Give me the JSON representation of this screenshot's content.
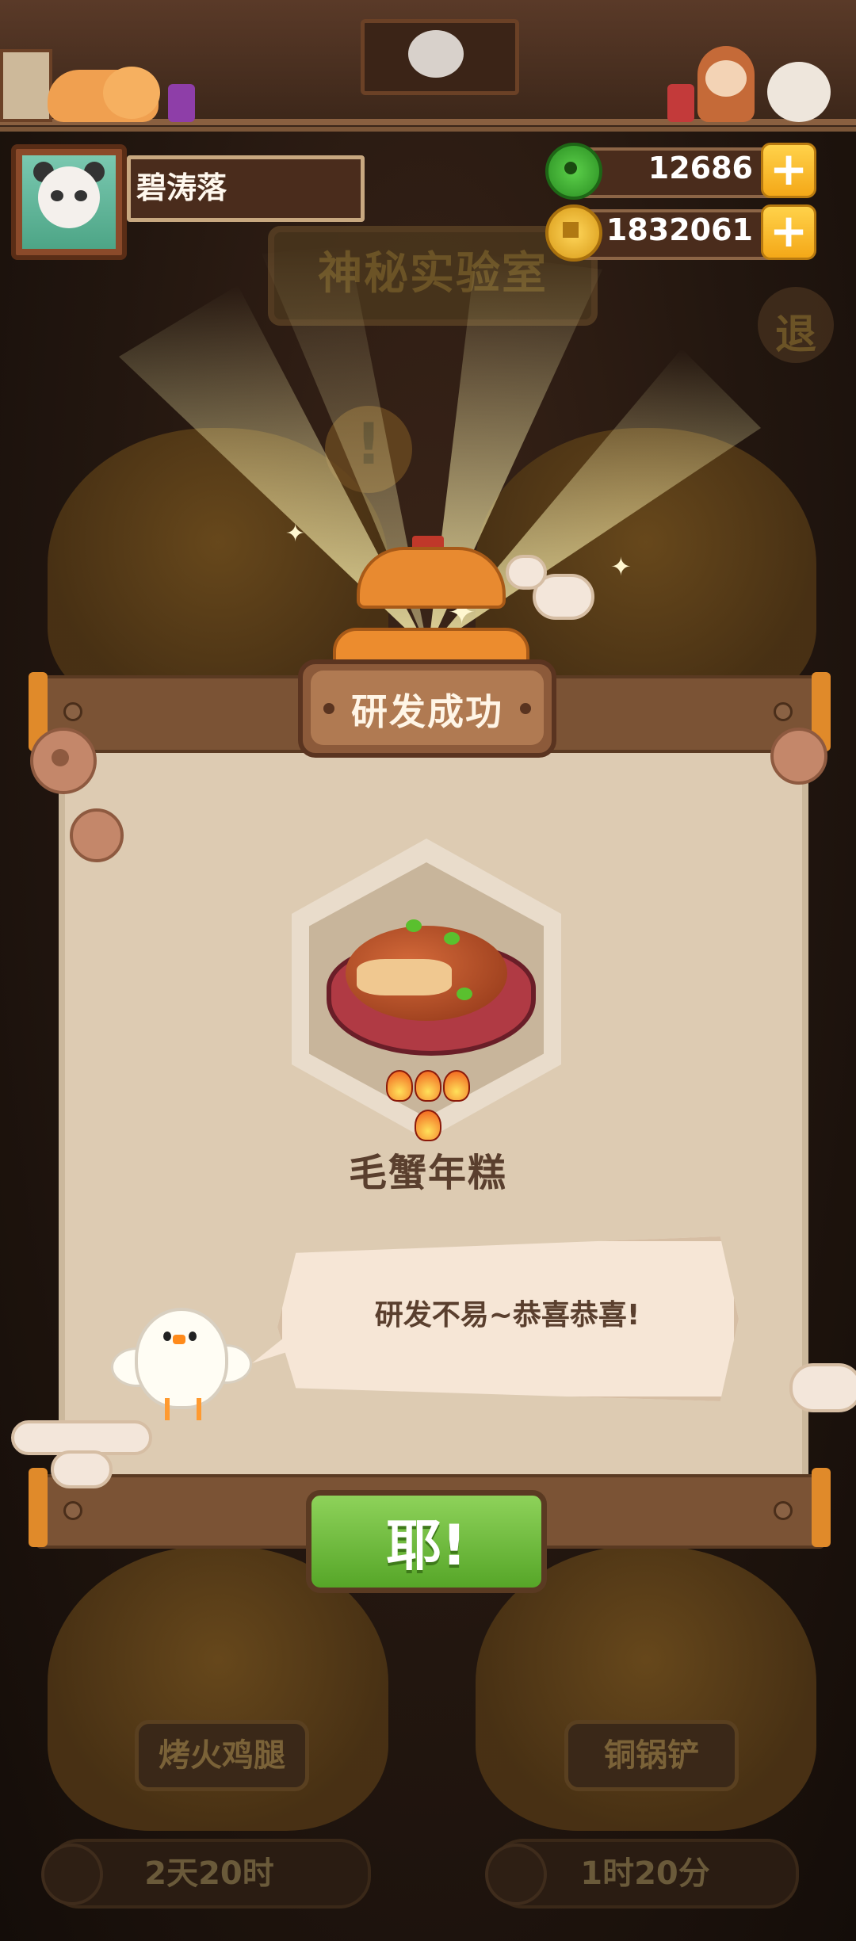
{
  "player": {
    "name": "碧涛落",
    "avatar_icon": "panda-avatar-icon"
  },
  "currencies": [
    {
      "name": "jade",
      "icon": "jade-icon",
      "value": "12686"
    },
    {
      "name": "coin",
      "icon": "copper-coin-icon",
      "value": "1832061"
    }
  ],
  "background": {
    "lab_title": "神秘实验室",
    "exit_label": "退",
    "alert_mark": "!",
    "pots": [
      {
        "label": "烤火鸡腿",
        "timer": "2天20时"
      },
      {
        "label": "铜锅铲",
        "timer": "1时20分"
      }
    ]
  },
  "dialog": {
    "title": "研发成功",
    "dish": {
      "name": "毛蟹年糕",
      "icon": "crab-rice-cake-dish-icon",
      "spice_level": 4,
      "spice_icon": "flame-icon"
    },
    "mascot_icon": "chick-mascot-icon",
    "message": "研发不易~恭喜恭喜!",
    "confirm_label": "耶!"
  },
  "colors": {
    "panel_wood": "#7b5335",
    "paper": "#ddcbb2",
    "confirm_green": "#6cbc3a",
    "gold": "#f4a818",
    "text_brown": "#5a3f2e"
  }
}
